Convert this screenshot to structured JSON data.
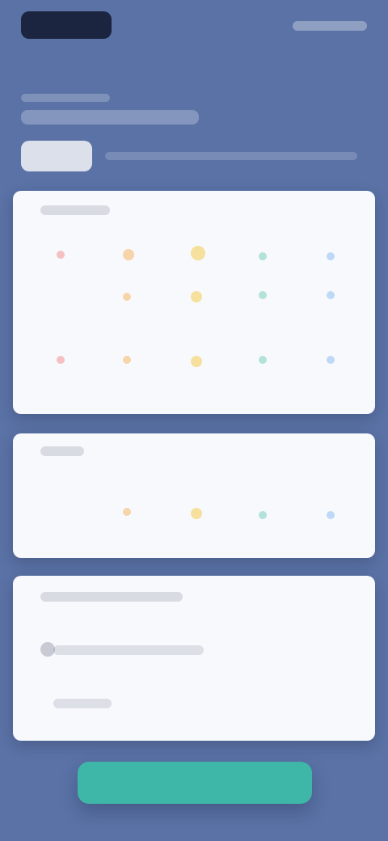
{
  "page": {
    "background_color": "#5a72a6"
  },
  "brand": {
    "logo_color": "#1b2540"
  },
  "cta": {
    "label": ""
  },
  "colors": {
    "accent_teal": "#3fb7a8",
    "dot_red": "#f2a3a3",
    "dot_yellow": "#f6d36a",
    "dot_orange": "#f7c27e",
    "dot_green": "#8fd7c8",
    "dot_blue": "#9ec8f2"
  },
  "panels": {
    "p1": {
      "dots": [
        {
          "color": "dot_red"
        },
        {
          "color": "dot_orange"
        },
        {
          "color": "dot_yellow"
        },
        {
          "color": "dot_green"
        },
        {
          "color": "dot_blue"
        },
        {
          "color": "dot_orange"
        },
        {
          "color": "dot_yellow"
        },
        {
          "color": "dot_green"
        },
        {
          "color": "dot_blue"
        },
        {
          "color": "dot_red"
        },
        {
          "color": "dot_orange"
        },
        {
          "color": "dot_yellow"
        },
        {
          "color": "dot_green"
        },
        {
          "color": "dot_blue"
        }
      ]
    },
    "p2": {
      "dots": [
        {
          "color": "dot_orange"
        },
        {
          "color": "dot_yellow"
        },
        {
          "color": "dot_green"
        },
        {
          "color": "dot_blue"
        }
      ]
    },
    "p3": {}
  }
}
